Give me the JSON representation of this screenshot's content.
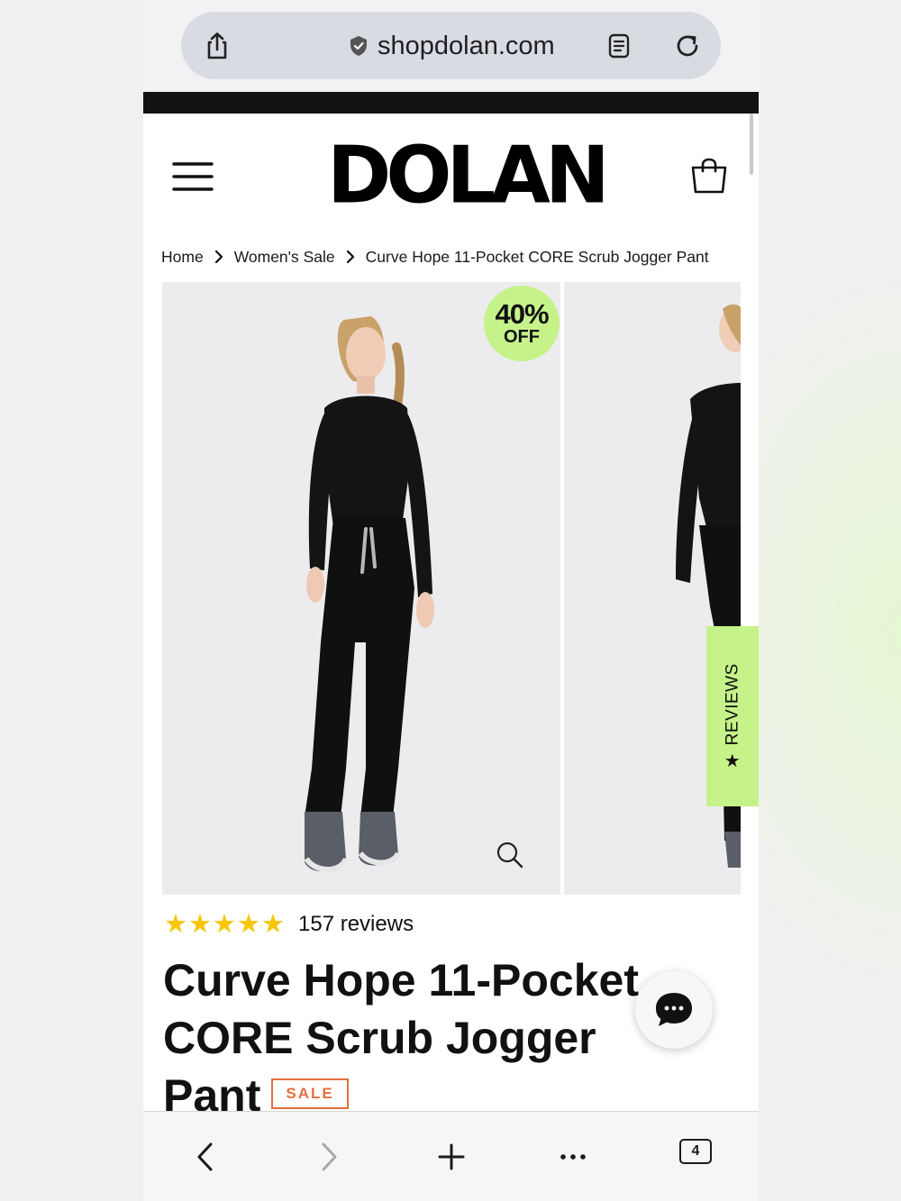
{
  "browser": {
    "url": "shopdolan.com",
    "share_icon": "share-icon",
    "secure_icon": "shield-check-icon",
    "reader_icon": "reader-mode-icon",
    "reload_icon": "reload-icon",
    "tab_count": "4"
  },
  "header": {
    "logo": "DOLAN",
    "menu_icon": "hamburger-menu-icon",
    "cart_icon": "shopping-bag-icon"
  },
  "breadcrumb": [
    "Home",
    "Women's Sale",
    "Curve Hope 11-Pocket CORE Scrub Jogger Pant"
  ],
  "gallery": {
    "badge_percent": "40%",
    "badge_off": "OFF",
    "zoom_icon": "zoom-icon"
  },
  "reviews_tab": {
    "label": "REVIEWS",
    "icon": "star-icon"
  },
  "product": {
    "rating": 5,
    "review_count": "157 reviews",
    "title": "Curve Hope 11-Pocket CORE Scrub Jogger Pant",
    "sale_label": "SALE"
  },
  "colors": {
    "accent_green": "#c6f28a",
    "star_yellow": "#f7c600",
    "sale_orange": "#e3703d"
  },
  "bottom_nav": [
    "back-icon",
    "forward-icon",
    "new-tab-icon",
    "more-icon",
    "tabs-icon"
  ]
}
